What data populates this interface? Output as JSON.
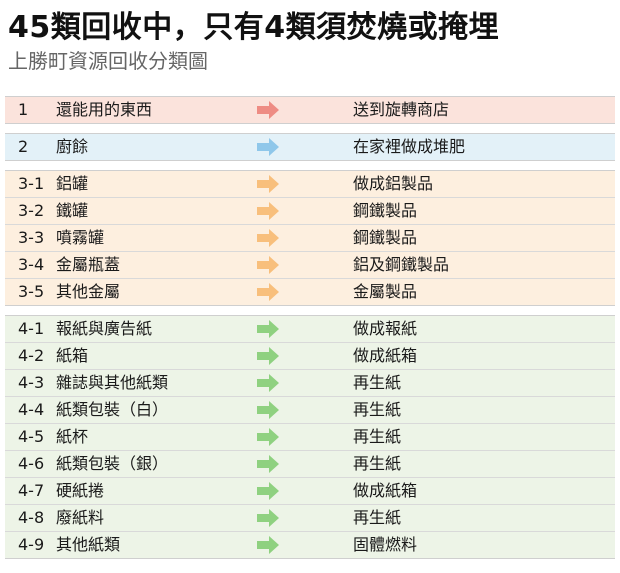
{
  "title": "45類回收中，只有4類須焚燒或掩埋",
  "subtitle": "上勝町資源回收分類圖",
  "groups": [
    {
      "color": "#fbe3dc",
      "arrow_color": "#ee8c84",
      "rows": [
        {
          "num": "1",
          "item": "還能用的東西",
          "dest": "送到旋轉商店"
        }
      ]
    },
    {
      "color": "#e3f1f8",
      "arrow_color": "#8fc7ea",
      "rows": [
        {
          "num": "2",
          "item": "廚餘",
          "dest": "在家裡做成堆肥"
        }
      ]
    },
    {
      "color": "#fdefdf",
      "arrow_color": "#f8bf7c",
      "rows": [
        {
          "num": "3-1",
          "item": "鋁罐",
          "dest": "做成鋁製品"
        },
        {
          "num": "3-2",
          "item": "鐵罐",
          "dest": "鋼鐵製品"
        },
        {
          "num": "3-3",
          "item": "噴霧罐",
          "dest": "鋼鐵製品"
        },
        {
          "num": "3-4",
          "item": "金屬瓶蓋",
          "dest": "鋁及鋼鐵製品"
        },
        {
          "num": "3-5",
          "item": "其他金屬",
          "dest": "金屬製品"
        }
      ]
    },
    {
      "color": "#edf4e7",
      "arrow_color": "#8fd180",
      "rows": [
        {
          "num": "4-1",
          "item": "報紙與廣告紙",
          "dest": "做成報紙"
        },
        {
          "num": "4-2",
          "item": "紙箱",
          "dest": "做成紙箱"
        },
        {
          "num": "4-3",
          "item": "雜誌與其他紙類",
          "dest": "再生紙"
        },
        {
          "num": "4-4",
          "item": "紙類包裝（白）",
          "dest": "再生紙"
        },
        {
          "num": "4-5",
          "item": "紙杯",
          "dest": "再生紙"
        },
        {
          "num": "4-6",
          "item": "紙類包裝（銀）",
          "dest": "再生紙"
        },
        {
          "num": "4-7",
          "item": "硬紙捲",
          "dest": "做成紙箱"
        },
        {
          "num": "4-8",
          "item": "廢紙料",
          "dest": "再生紙"
        },
        {
          "num": "4-9",
          "item": "其他紙類",
          "dest": "固體燃料"
        }
      ]
    }
  ]
}
